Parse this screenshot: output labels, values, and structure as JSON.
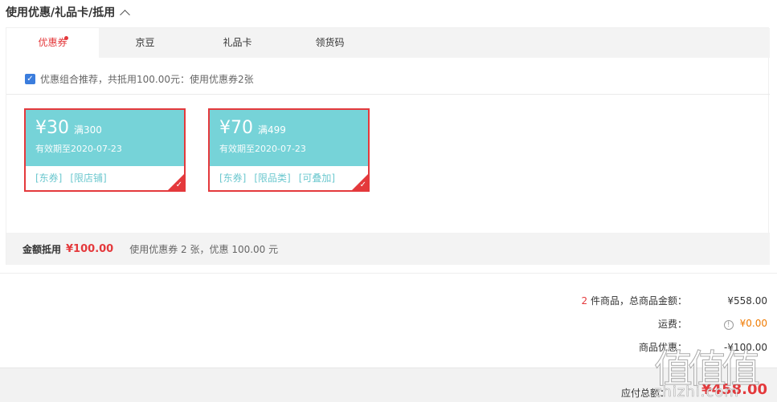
{
  "section": {
    "title": "使用优惠/礼品卡/抵用"
  },
  "tabs": [
    {
      "label": "优惠券",
      "active": true
    },
    {
      "label": "京豆"
    },
    {
      "label": "礼品卡"
    },
    {
      "label": "领货码"
    }
  ],
  "recommend": {
    "checked": true,
    "text": "优惠组合推荐，共抵用100.00元：使用优惠券2张"
  },
  "coupons": [
    {
      "amount": "¥30",
      "condition": "满300",
      "expire": "有效期至2020-07-23",
      "tags": [
        "[东券]",
        "[限店铺]"
      ]
    },
    {
      "amount": "¥70",
      "condition": "满499",
      "expire": "有效期至2020-07-23",
      "tags": [
        "[东券]",
        "[限品类]",
        "[可叠加]"
      ]
    }
  ],
  "summary": {
    "label": "金额抵用",
    "amount": "¥100.00",
    "desc": "使用优惠券 2 张，优惠 100.00 元"
  },
  "totals": {
    "items_count": "2",
    "items_label": " 件商品，总商品金额：",
    "items_value": "¥558.00",
    "shipping_label": "运费：",
    "shipping_value": "¥0.00",
    "discount_label": "商品优惠：",
    "discount_value": "-¥100.00"
  },
  "footer": {
    "label": "应付总额：",
    "total": "¥458.00"
  },
  "watermark": {
    "glyph": "值值值",
    "site": "zhizhi.com"
  },
  "colors": {
    "accent": "#e4393c",
    "coupon": "#76d3d8",
    "checkbox": "#3b7ddd"
  }
}
